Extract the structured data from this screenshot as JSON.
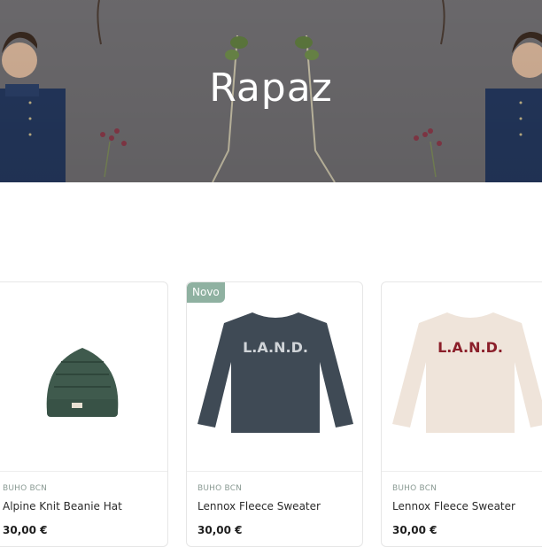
{
  "hero": {
    "title": "Rapaz"
  },
  "products": [
    {
      "badge": "",
      "brand": "BUHO BCN",
      "name": "Alpine Knit Beanie Hat",
      "price": "30,00 €",
      "image_icon": "green-beanie-image",
      "color": "#3f5a4d"
    },
    {
      "badge": "Novo",
      "brand": "BUHO BCN",
      "name": "Lennox Fleece Sweater",
      "price": "30,00 €",
      "image_icon": "navy-sweater-image",
      "color": "#3f4a55",
      "print_text": "L.A.N.D."
    },
    {
      "badge": "",
      "brand": "BUHO BCN",
      "name": "Lennox Fleece Sweater",
      "price": "30,00 €",
      "image_icon": "cream-sweater-image",
      "color": "#efe4da",
      "print_text": "L.A.N.D."
    }
  ],
  "colors": {
    "badge": "#8fb1a1",
    "hero_overlay": "#6f6d70"
  }
}
